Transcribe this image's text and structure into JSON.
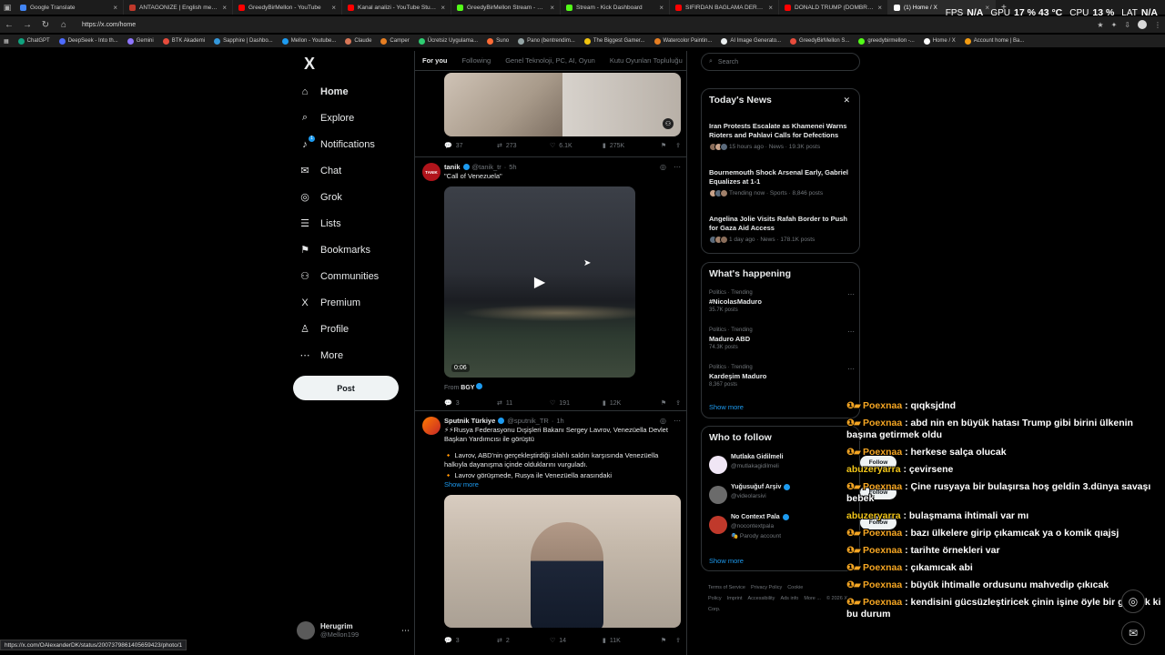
{
  "browser": {
    "tabs": [
      {
        "title": "Google Translate",
        "color": "#4285f4"
      },
      {
        "title": "ANTAGONIZE | English meaning",
        "color": "#c0392b"
      },
      {
        "title": "GreedyBirMellon - YouTube",
        "color": "#ff0000"
      },
      {
        "title": "Kanal analizi - YouTube Studio",
        "color": "#ff0000"
      },
      {
        "title": "GreedyBirMellon Stream - Watch",
        "color": "#53fc18"
      },
      {
        "title": "Stream - Kick Dashboard",
        "color": "#53fc18"
      },
      {
        "title": "SIFIRDAN BAĞLAMA DERSİ 7 | BU",
        "color": "#ff0000"
      },
      {
        "title": "DONALD TRUMP (DOMBRA TRAP",
        "color": "#ff0000"
      },
      {
        "title": "(1) Home / X",
        "color": "#ffffff"
      }
    ],
    "url": "https://x.com/home",
    "status_url": "https://x.com/OAlexanderDK/status/2007379861405659423/photo/1",
    "bookmarks": [
      {
        "label": "ChatGPT",
        "color": "#10a37f"
      },
      {
        "label": "DeepSeek - Into th...",
        "color": "#4d6bfe"
      },
      {
        "label": "Gemini",
        "color": "#8e75ff"
      },
      {
        "label": "BTK Akademi",
        "color": "#e74c3c"
      },
      {
        "label": "Sapphire | Dashbo...",
        "color": "#3498db"
      },
      {
        "label": "Mellon - Youtube...",
        "color": "#1d9bf0"
      },
      {
        "label": "Claude",
        "color": "#d97757"
      },
      {
        "label": "Camper",
        "color": "#e67e22"
      },
      {
        "label": "Ücretsiz Uygulama...",
        "color": "#2ecc71"
      },
      {
        "label": "Suno",
        "color": "#ff6b35"
      },
      {
        "label": "Pano (bentrendim...",
        "color": "#95a5a6"
      },
      {
        "label": "The Biggest Gamer...",
        "color": "#f1c40f"
      },
      {
        "label": "Watercolor Paintin...",
        "color": "#e67e22"
      },
      {
        "label": "AI Image Generato...",
        "color": "#ecf0f1"
      },
      {
        "label": "GreedyBirMellon S...",
        "color": "#e74c3c"
      },
      {
        "label": "greedybirmellon -...",
        "color": "#53fc18"
      },
      {
        "label": "Home / X",
        "color": "#ffffff"
      },
      {
        "label": "Account home | Ba...",
        "color": "#f39c12"
      }
    ]
  },
  "overlay_stats": {
    "fps_label": "FPS",
    "fps_value": "N/A",
    "gpu_label": "GPU",
    "gpu_value": "17 %  43 °C",
    "cpu_label": "CPU",
    "cpu_value": "13 %",
    "lat_label": "LAT",
    "lat_value": "N/A"
  },
  "nav": {
    "logo": "X",
    "items": [
      {
        "label": "Home",
        "icon": "⌂"
      },
      {
        "label": "Explore",
        "icon": "⌕"
      },
      {
        "label": "Notifications",
        "icon": "♪"
      },
      {
        "label": "Chat",
        "icon": "✉"
      },
      {
        "label": "Grok",
        "icon": "◎"
      },
      {
        "label": "Lists",
        "icon": "☰"
      },
      {
        "label": "Bookmarks",
        "icon": "⚑"
      },
      {
        "label": "Communities",
        "icon": "⚇"
      },
      {
        "label": "Premium",
        "icon": "X"
      },
      {
        "label": "Profile",
        "icon": "♙"
      },
      {
        "label": "More",
        "icon": "⋯"
      }
    ],
    "notif_badge": "1",
    "post_label": "Post",
    "profile": {
      "name": "Herugrim",
      "handle": "@Mellon199"
    }
  },
  "feed": {
    "tabs": [
      "For you",
      "Following",
      "Genel Teknoloji, PC, AI, Oyun",
      "Kutu Oyunları Topluluğu"
    ],
    "top_actions": {
      "replies": "37",
      "reposts": "273",
      "likes": "6.1K",
      "views": "275K"
    },
    "tweet1": {
      "name": "tanik",
      "handle": "@tanik_tr",
      "time": "5h",
      "avatar_text": "TANIK",
      "text": "\"Call of Venezuela\"",
      "video_time": "0:06",
      "from_label": "From",
      "from_name": "BGY",
      "actions": {
        "replies": "3",
        "reposts": "11",
        "likes": "191",
        "views": "12K"
      }
    },
    "tweet2": {
      "name": "Sputnik Türkiye",
      "handle": "@sputnik_TR",
      "time": "1h",
      "line1": "⚡⚡Rusya Federasyonu Dışişleri Bakanı Sergey Lavrov, Venezüella Devlet Başkan Yardımcısı ile görüştü",
      "line2": "🔸 Lavrov, ABD'nin gerçekleştirdiği silahlı saldırı karşısında Venezüella halkıyla dayanışma içinde olduklarını vurguladı.",
      "line3": "🔸 Lavrov görüşmede, Rusya ile Venezüella arasındaki",
      "show_more": "Show more",
      "actions": {
        "replies": "3",
        "reposts": "2",
        "likes": "14",
        "views": "11K"
      }
    }
  },
  "right": {
    "search_placeholder": "Search",
    "news": {
      "title": "Today's News",
      "items": [
        {
          "headline": "Iran Protests Escalate as Khamenei Warns Rioters and Pahlavi Calls for Defections",
          "meta": "15 hours ago · News · 19.3K posts"
        },
        {
          "headline": "Bournemouth Shock Arsenal Early, Gabriel Equalizes at 1-1",
          "meta": "Trending now · Sports · 8,846 posts"
        },
        {
          "headline": "Angelina Jolie Visits Rafah Border to Push for Gaza Aid Access",
          "meta": "1 day ago · News · 178.1K posts"
        }
      ]
    },
    "happening": {
      "title": "What's happening",
      "items": [
        {
          "category": "Politics · Trending",
          "name": "#NicolasMaduro",
          "count": "35.7K posts"
        },
        {
          "category": "Politics · Trending",
          "name": "Maduro ABD",
          "count": "74.3K posts"
        },
        {
          "category": "Politics · Trending",
          "name": "Kardeşim Maduro",
          "count": "8,367 posts"
        }
      ],
      "show_more": "Show more"
    },
    "who_to_follow": {
      "title": "Who to follow",
      "items": [
        {
          "name": "Mutlaka Gidilmeli",
          "handle": "@mutlakagidilmeli",
          "sub": "",
          "follow": "Follow"
        },
        {
          "name": "Yuğusuğuf Arşiv",
          "handle": "@videolarsivi",
          "sub": "",
          "follow": "Follow"
        },
        {
          "name": "No Context Pala",
          "handle": "@nocontextpala",
          "sub": "Parody account",
          "follow": "Follow"
        }
      ],
      "show_more": "Show more"
    },
    "footer": [
      "Terms of Service",
      "Privacy Policy",
      "Cookie Policy",
      "Imprint",
      "Accessibility",
      "Ads info",
      "More ...",
      "© 2026 X Corp."
    ]
  },
  "chat": [
    {
      "user": "Poexnaa",
      "text": "qıqksjdnd"
    },
    {
      "user": "Poexnaa",
      "text": "abd nin en büyük hatası Trump gibi birini ülkenin başına getirmek oldu"
    },
    {
      "user": "Poexnaa",
      "text": "herkese salça olucak"
    },
    {
      "user": "abuzeryarra",
      "text": "çevirsene"
    },
    {
      "user": "Poexnaa",
      "text": "Çine rusyaya bir bulaşırsa hoş geldin 3.dünya savaşı bebek"
    },
    {
      "user": "abuzeryarra",
      "text": "bulaşmama ihtimali var mı"
    },
    {
      "user": "Poexnaa",
      "text": "bazı ülkelere girip çıkamıcak ya o komik qıajsj"
    },
    {
      "user": "Poexnaa",
      "text": "tarihte örnekleri var"
    },
    {
      "user": "Poexnaa",
      "text": "çıkamıcak abi"
    },
    {
      "user": "Poexnaa",
      "text": "büyük ihtimalle ordusunu mahvedip çıkıcak"
    },
    {
      "user": "Poexnaa",
      "text": "kendisini gücsüzleştiricek çinin işine öyle bir gelicek ki bu durum"
    }
  ]
}
